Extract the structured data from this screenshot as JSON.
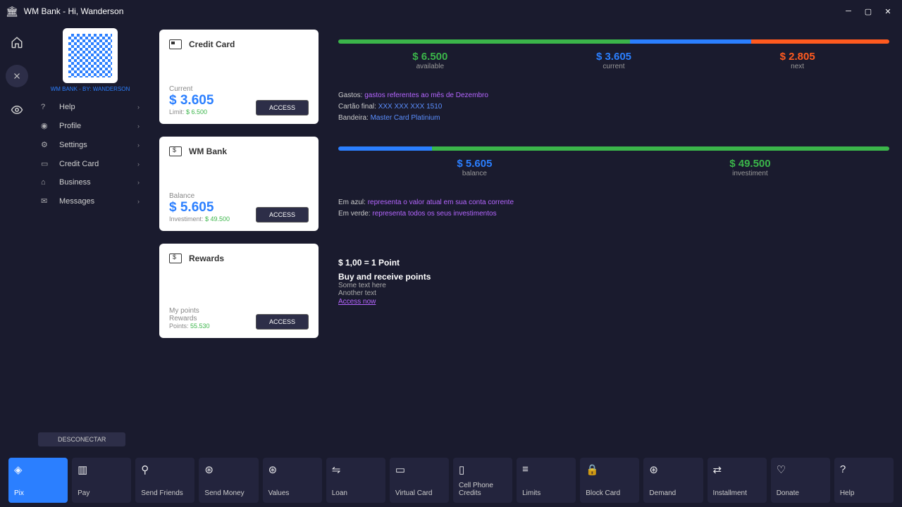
{
  "window": {
    "title": "WM Bank - Hi, Wanderson"
  },
  "sidebar": {
    "qr_label": "WM BANK - BY: WANDERSON",
    "items": [
      {
        "label": "Help",
        "icon": "help-icon"
      },
      {
        "label": "Profile",
        "icon": "profile-icon"
      },
      {
        "label": "Settings",
        "icon": "settings-icon"
      },
      {
        "label": "Credit Card",
        "icon": "creditcard-icon"
      },
      {
        "label": "Business",
        "icon": "business-icon"
      },
      {
        "label": "Messages",
        "icon": "messages-icon"
      }
    ]
  },
  "cards": {
    "credit": {
      "title": "Credit Card",
      "label": "Current",
      "amount": "$ 3.605",
      "sub_prefix": "Limit: ",
      "sub_value": "$ 6.500",
      "button": "ACCESS"
    },
    "bank": {
      "title": "WM Bank",
      "label": "Balance",
      "amount": "$ 5.605",
      "sub_prefix": "Investiment: ",
      "sub_value": "$ 49.500",
      "button": "ACCESS"
    },
    "rewards": {
      "title": "Rewards",
      "l1": "My points",
      "l2": "Rewards",
      "sub_prefix": "Points: ",
      "sub_value": "55.530",
      "button": "ACCESS"
    }
  },
  "panel_credit": {
    "segments": [
      {
        "color": "#3bb54a",
        "width": "53%"
      },
      {
        "color": "#2b7fff",
        "width": "22%"
      },
      {
        "color": "#ff5a1f",
        "width": "25%"
      }
    ],
    "stats": [
      {
        "value": "$ 6.500",
        "label": "available",
        "color": "#3bb54a"
      },
      {
        "value": "$ 3.605",
        "label": "current",
        "color": "#2b7fff"
      },
      {
        "value": "$ 2.805",
        "label": "next",
        "color": "#ff5a1f"
      }
    ],
    "lines": [
      {
        "key": "Gastos:",
        "value": "gastos referentes ao mês de Dezembro",
        "class": "val-purple"
      },
      {
        "key": "Cartão final:",
        "value": "XXX XXX XXX 1510",
        "class": "val-blue"
      },
      {
        "key": "Bandeira:",
        "value": "Master Card Platinium",
        "class": "val-blue"
      }
    ]
  },
  "panel_bank": {
    "segments": [
      {
        "color": "#2b7fff",
        "width": "17%"
      },
      {
        "color": "#3bb54a",
        "width": "83%"
      }
    ],
    "stats": [
      {
        "value": "$ 5.605",
        "label": "balance",
        "color": "#2b7fff"
      },
      {
        "value": "$ 49.500",
        "label": "investiment",
        "color": "#3bb54a"
      }
    ],
    "lines": [
      {
        "key": "Em azul:",
        "value": "representa o valor atual em sua conta corrente",
        "class": "val-purple"
      },
      {
        "key": "Em verde:",
        "value": "representa todos os seus investimentos",
        "class": "val-purple"
      }
    ]
  },
  "panel_rewards": {
    "rate": "$ 1,00 = 1 Point",
    "headline": "Buy and receive points",
    "line1": "Some text here",
    "line2": "Another text",
    "link": "Access now"
  },
  "disconnect": "DESCONECTAR",
  "bottom": [
    {
      "label": "Pix",
      "icon": "◈"
    },
    {
      "label": "Pay",
      "icon": "▥"
    },
    {
      "label": "Send Friends",
      "icon": "⚲"
    },
    {
      "label": "Send Money",
      "icon": "⊛"
    },
    {
      "label": "Values",
      "icon": "⊛"
    },
    {
      "label": "Loan",
      "icon": "⇋"
    },
    {
      "label": "Virtual Card",
      "icon": "▭"
    },
    {
      "label": "Cell Phone Credits",
      "icon": "▯"
    },
    {
      "label": "Limits",
      "icon": "≡"
    },
    {
      "label": "Block Card",
      "icon": "🔒"
    },
    {
      "label": "Demand",
      "icon": "⊛"
    },
    {
      "label": "Installment",
      "icon": "⇄"
    },
    {
      "label": "Donate",
      "icon": "♡"
    },
    {
      "label": "Help",
      "icon": "?"
    }
  ]
}
